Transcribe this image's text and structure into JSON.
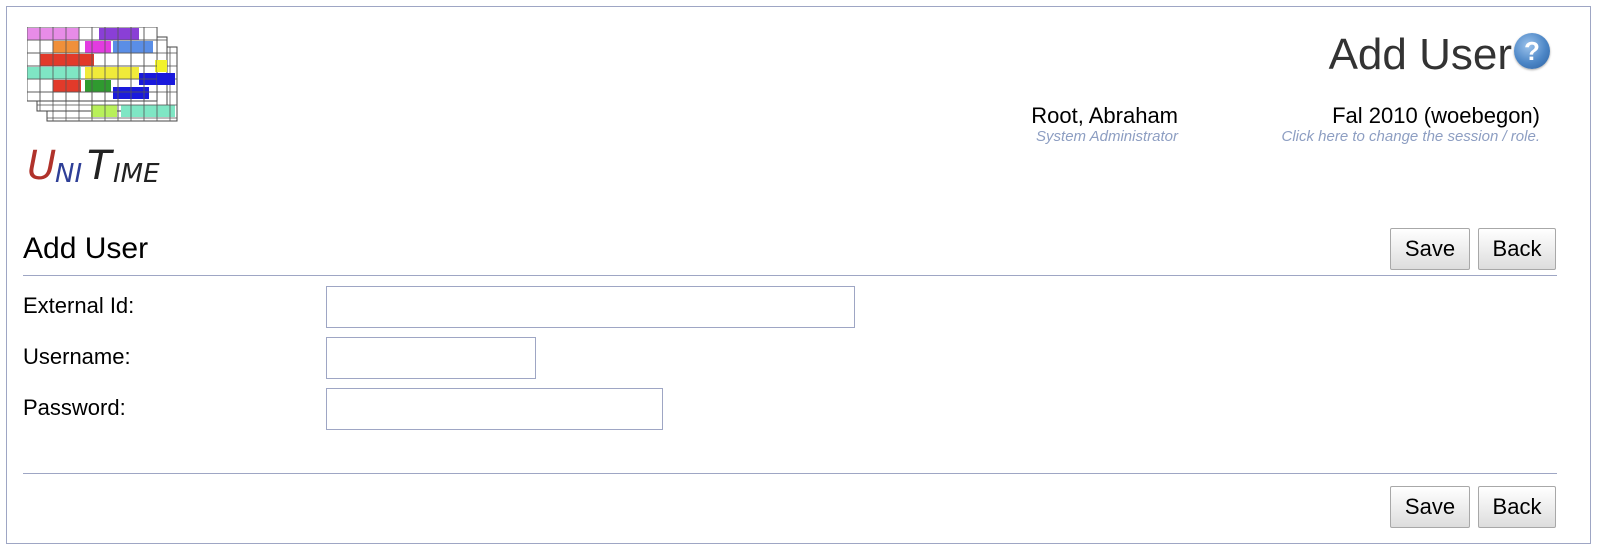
{
  "header": {
    "page_title": "Add User",
    "help_icon": "help-icon",
    "user": {
      "name": "Root, Abraham",
      "role": "System Administrator"
    },
    "session": {
      "name": "Fal 2010 (woebegon)",
      "hint": "Click here to change the session / role."
    }
  },
  "logo": {
    "parts": [
      "U",
      "NI",
      "T",
      "IME"
    ]
  },
  "form": {
    "title": "Add User",
    "save_label": "Save",
    "back_label": "Back",
    "fields": [
      {
        "label": "External Id:",
        "value": "",
        "placeholder": ""
      },
      {
        "label": "Username:",
        "value": "",
        "placeholder": ""
      },
      {
        "label": "Password:",
        "value": "",
        "placeholder": ""
      }
    ]
  },
  "colors": {
    "accent": "#9ea6c4",
    "subtext": "#8d9ec2",
    "help": "#4c86c6"
  }
}
